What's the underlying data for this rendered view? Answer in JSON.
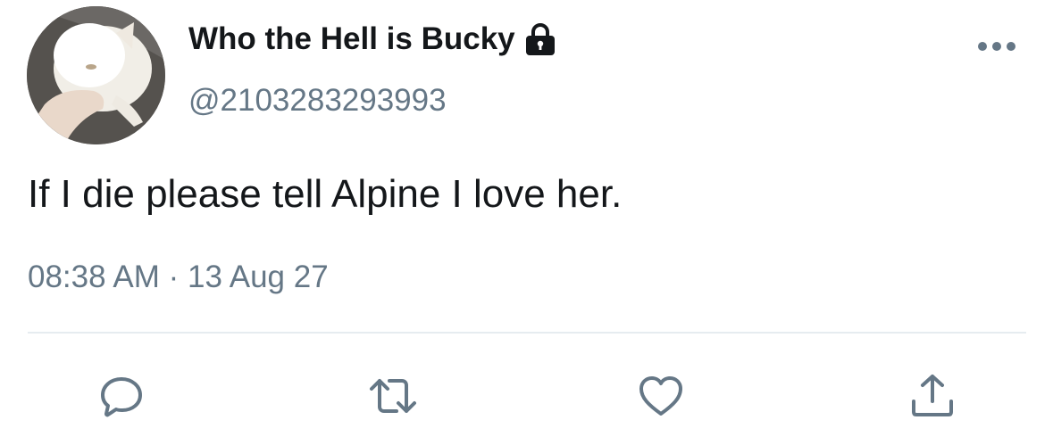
{
  "tweet": {
    "display_name": "Who the Hell is Bucky",
    "handle": "@2103283293993",
    "text": "If I die please tell Alpine I love her.",
    "time": "08:38 AM",
    "separator": "·",
    "date": "13 Aug 27"
  },
  "icons": {
    "lock": "lock-icon",
    "more": "more-icon",
    "reply": "reply-icon",
    "retweet": "retweet-icon",
    "like": "heart-icon",
    "share": "share-icon"
  },
  "colors": {
    "primary_text": "#14171a",
    "secondary_text": "#657786",
    "divider": "#e6ecf0"
  }
}
